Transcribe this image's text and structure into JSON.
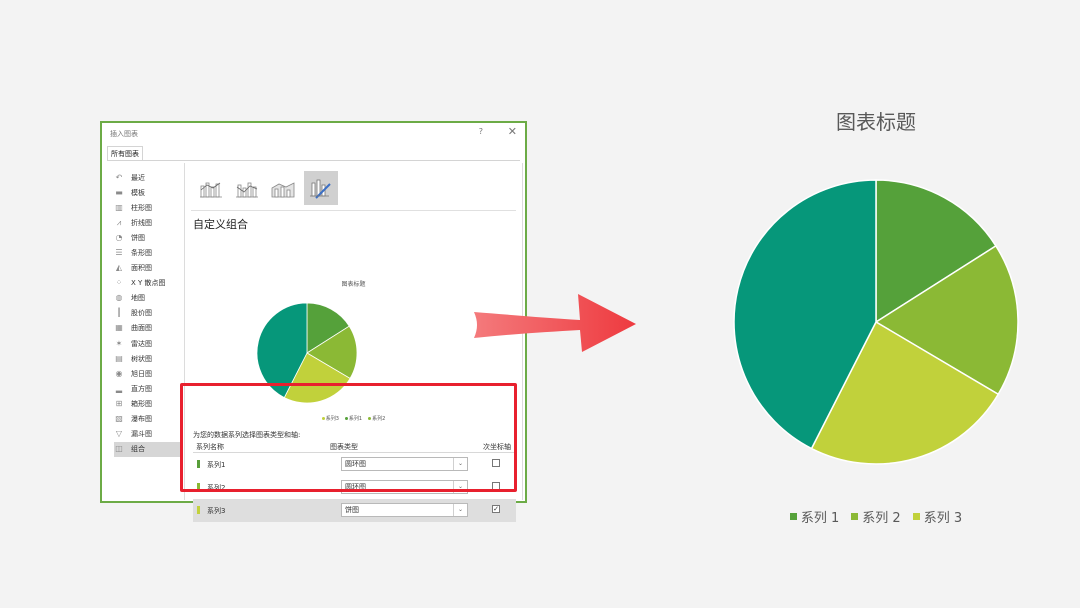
{
  "dialog": {
    "title": "插入图表",
    "help": "?",
    "close": "✕",
    "tab": "所有图表",
    "chart_types": [
      {
        "label": "最近",
        "icon": "recent-icon",
        "glyph": "↶"
      },
      {
        "label": "模板",
        "icon": "folder-icon",
        "glyph": "▬"
      },
      {
        "label": "柱形图",
        "icon": "column-chart-icon",
        "glyph": "▥"
      },
      {
        "label": "折线图",
        "icon": "line-chart-icon",
        "glyph": "⩘"
      },
      {
        "label": "饼图",
        "icon": "pie-chart-icon",
        "glyph": "◔"
      },
      {
        "label": "条形图",
        "icon": "bar-chart-icon",
        "glyph": "☰"
      },
      {
        "label": "面积图",
        "icon": "area-chart-icon",
        "glyph": "◭"
      },
      {
        "label": "X Y 散点图",
        "icon": "scatter-chart-icon",
        "glyph": "⁘"
      },
      {
        "label": "地图",
        "icon": "map-chart-icon",
        "glyph": "◍"
      },
      {
        "label": "股价图",
        "icon": "stock-chart-icon",
        "glyph": "┃"
      },
      {
        "label": "曲面图",
        "icon": "surface-chart-icon",
        "glyph": "▦"
      },
      {
        "label": "雷达图",
        "icon": "radar-chart-icon",
        "glyph": "✶"
      },
      {
        "label": "树状图",
        "icon": "treemap-chart-icon",
        "glyph": "▤"
      },
      {
        "label": "旭日图",
        "icon": "sunburst-chart-icon",
        "glyph": "◉"
      },
      {
        "label": "直方图",
        "icon": "histogram-chart-icon",
        "glyph": "▂"
      },
      {
        "label": "箱形图",
        "icon": "boxplot-chart-icon",
        "glyph": "⊞"
      },
      {
        "label": "瀑布图",
        "icon": "waterfall-chart-icon",
        "glyph": "▧"
      },
      {
        "label": "漏斗图",
        "icon": "funnel-chart-icon",
        "glyph": "▽"
      },
      {
        "label": "组合",
        "icon": "combo-chart-icon",
        "glyph": "◫"
      }
    ],
    "selected_type_index": 18,
    "combo_title": "自定义组合",
    "preview": {
      "title": "图表标题",
      "legend": [
        "系列3",
        "系列1",
        "系列2"
      ]
    },
    "instruction": "为您的数据系列选择图表类型和轴:",
    "table": {
      "col_name": "系列名称",
      "col_type": "图表类型",
      "col_axis": "次坐标轴",
      "rows": [
        {
          "name": "系列1",
          "type": "圆环图",
          "secondary": false,
          "color": "#589e3a"
        },
        {
          "name": "系列2",
          "type": "圆环图",
          "secondary": false,
          "color": "#8ab834"
        },
        {
          "name": "系列3",
          "type": "饼图",
          "secondary": true,
          "color": "#c2d13c"
        }
      ]
    }
  },
  "colors": {
    "teal": "#06977a",
    "series1": "#55a13a",
    "series2": "#8bb935",
    "series3": "#c1d13b",
    "arrow": "#f04b4f",
    "highlight_border": "#e8202e",
    "dialog_border": "#6cab46"
  },
  "chart_data": {
    "type": "pie",
    "title": "图表标题",
    "slices": [
      {
        "label": "",
        "value": 16,
        "color": "#55a13a"
      },
      {
        "label": "",
        "value": 17.5,
        "color": "#8bb935"
      },
      {
        "label": "",
        "value": 24,
        "color": "#c1d13b"
      },
      {
        "label": "",
        "value": 42.5,
        "color": "#06977a"
      }
    ],
    "legend": [
      "系列 1",
      "系列 2",
      "系列 3"
    ],
    "legend_colors": [
      "#55a13a",
      "#8bb935",
      "#c1d13b"
    ],
    "legend_position": "bottom"
  }
}
